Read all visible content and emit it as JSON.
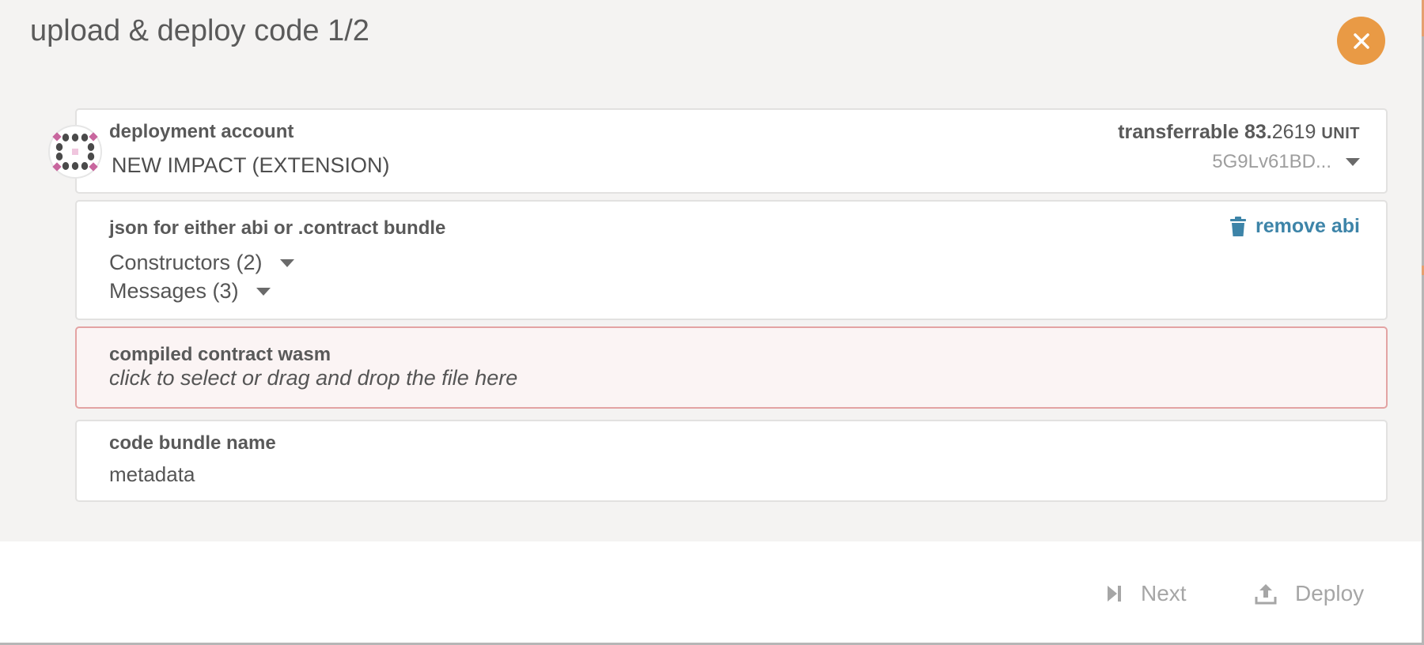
{
  "modal": {
    "title": "upload & deploy code 1/2"
  },
  "account": {
    "label": "deployment account",
    "name": "NEW IMPACT (EXTENSION)",
    "balance_label": "transferrable",
    "balance_int": "83.",
    "balance_dec": "2619",
    "unit": "UNIT",
    "address": "5G9Lv61BD..."
  },
  "abi": {
    "label": "json for either abi or .contract bundle",
    "remove_label": "remove abi",
    "constructors": "Constructors (2)",
    "messages": "Messages (3)"
  },
  "wasm": {
    "label": "compiled contract wasm",
    "placeholder": "click to select or drag and drop the file here"
  },
  "bundle": {
    "label": "code bundle name",
    "value": "metadata"
  },
  "footer": {
    "next_label": "Next",
    "deploy_label": "Deploy"
  },
  "colors": {
    "accent": "#e99a45",
    "link": "#3d84a8",
    "error_bg": "#fbf4f4",
    "error_border": "#e3a3a3"
  }
}
